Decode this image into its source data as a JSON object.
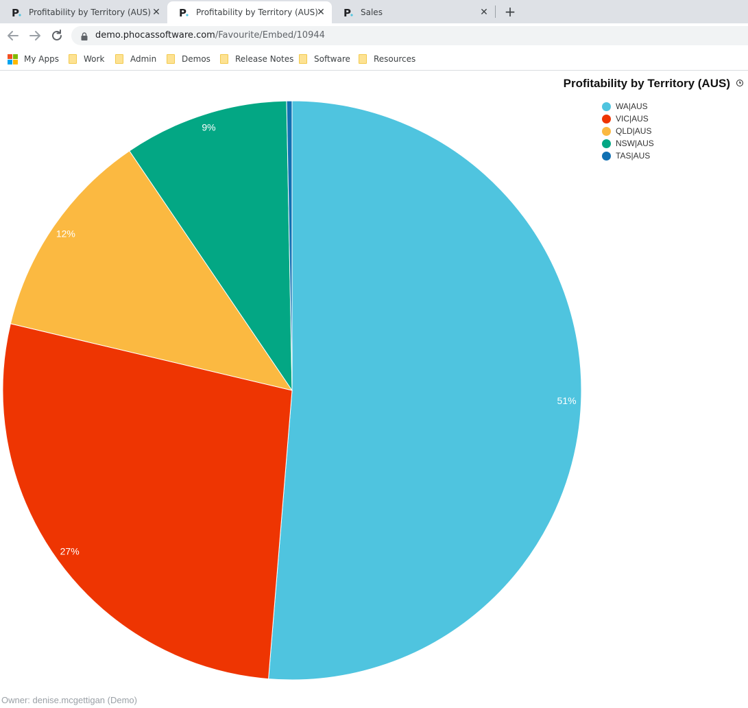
{
  "browser": {
    "tabs": [
      {
        "label": "Profitability by Territory (AUS)",
        "active": false
      },
      {
        "label": "Profitability by Territory (AUS)",
        "active": true
      },
      {
        "label": "Sales",
        "active": false
      }
    ],
    "url_host": "demo.phocassoftware.com",
    "url_path": "/Favourite/Embed/10944",
    "bookmarks": [
      "My Apps",
      "Work",
      "Admin",
      "Demos",
      "Release Notes",
      "Software",
      "Resources"
    ]
  },
  "colors": {
    "WA": "#4fc4df",
    "VIC": "#ee3502",
    "QLD": "#fbb941",
    "NSW": "#03a784",
    "TAS": "#1070b2"
  },
  "chart_data": {
    "type": "pie",
    "title": "Profitability by Territory (AUS)",
    "legend_position": "top-right",
    "slices": [
      {
        "name": "WA|AUS",
        "value": 51.3,
        "label": "51%",
        "color": "#4fc4df"
      },
      {
        "name": "VIC|AUS",
        "value": 27.4,
        "label": "27%",
        "color": "#ee3502"
      },
      {
        "name": "QLD|AUS",
        "value": 11.8,
        "label": "12%",
        "color": "#fbb941"
      },
      {
        "name": "NSW|AUS",
        "value": 9.2,
        "label": "9%",
        "color": "#03a784"
      },
      {
        "name": "TAS|AUS",
        "value": 0.3,
        "label": "",
        "color": "#1070b2"
      }
    ]
  },
  "footer": {
    "owner": "Owner: denise.mcgettigan (Demo)"
  }
}
